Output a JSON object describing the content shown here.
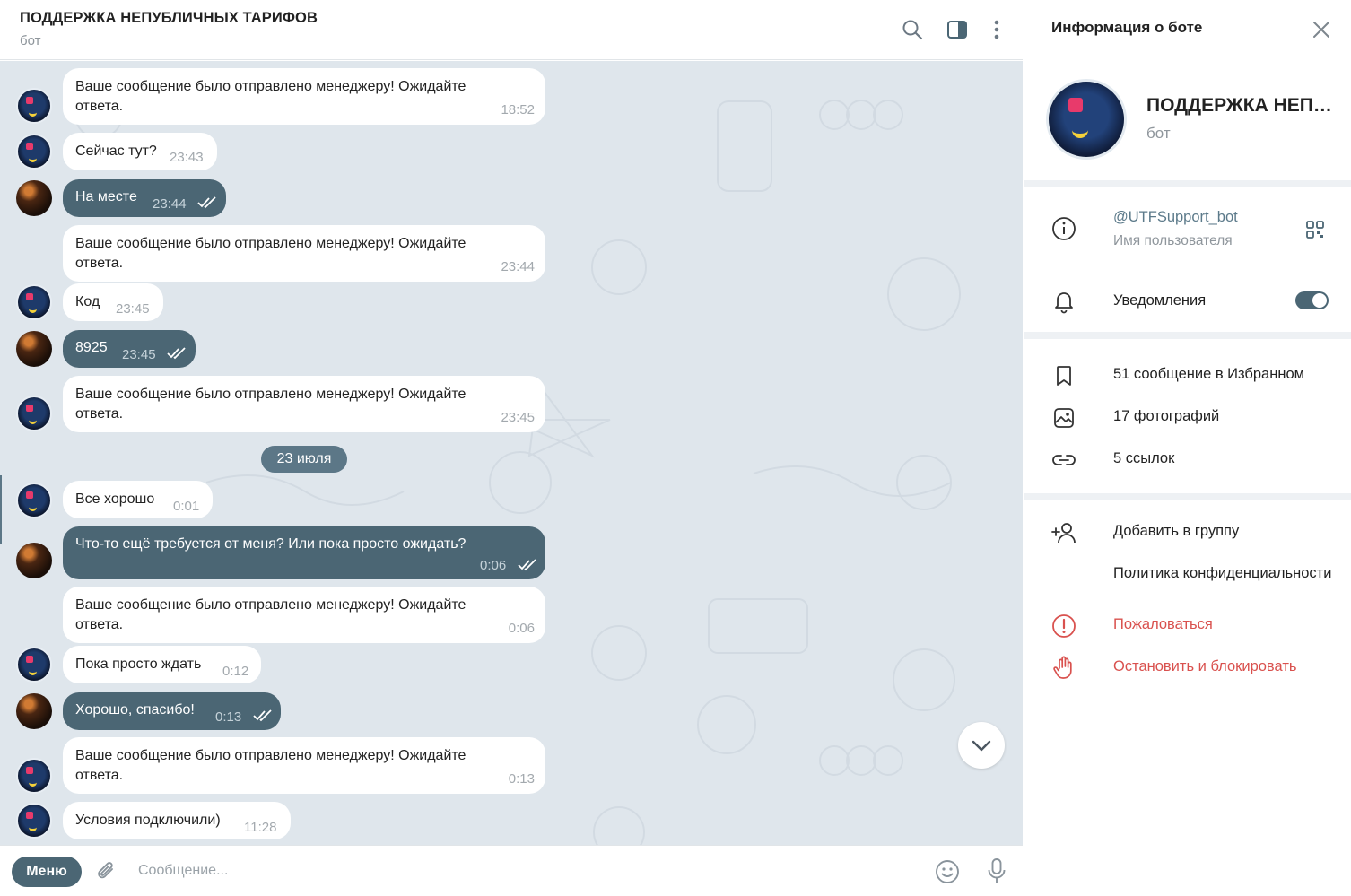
{
  "header": {
    "title": "ПОДДЕРЖКА НЕПУБЛИЧНЫХ ТАРИФОВ",
    "subtitle": "бот",
    "icons": [
      "search-icon",
      "sidebar-toggle-icon",
      "more-vertical-icon"
    ]
  },
  "messages": [
    {
      "from": "bot",
      "text": "Ваше сообщение было отправлено менеджеру! Ожидайте\nответа.",
      "time": "18:52"
    },
    {
      "from": "bot",
      "text": "Сейчас тут?",
      "time": "23:43"
    },
    {
      "from": "user",
      "text": "На месте",
      "time": "23:44"
    },
    {
      "from": "bot",
      "text": "Ваше сообщение было отправлено менеджеру! Ожидайте\nответа.",
      "time": "23:44"
    },
    {
      "from": "bot",
      "text": "Код",
      "time": "23:45"
    },
    {
      "from": "user",
      "text": "8925",
      "time": "23:45"
    },
    {
      "from": "bot",
      "text": "Ваше сообщение было отправлено менеджеру! Ожидайте\nответа.",
      "time": "23:45"
    },
    {
      "from": "bot",
      "text": "Все хорошо",
      "time": "0:01"
    },
    {
      "from": "user",
      "text": "Что-то ещё требуется от меня? Или пока просто ожидать?",
      "time": "0:06"
    },
    {
      "from": "bot",
      "text": "Ваше сообщение было отправлено менеджеру! Ожидайте\nответа.",
      "time": "0:06"
    },
    {
      "from": "bot",
      "text": "Пока просто ждать",
      "time": "0:12"
    },
    {
      "from": "user",
      "text": "Хорошо, спасибо!",
      "time": "0:13"
    },
    {
      "from": "bot",
      "text": "Ваше сообщение было отправлено менеджеру! Ожидайте\nответа.",
      "time": "0:13"
    },
    {
      "from": "bot",
      "text": "Условия подключили)",
      "time": "11:28"
    }
  ],
  "date_separator": "23 июля",
  "composer": {
    "menu_label": "Меню",
    "placeholder": "Сообщение..."
  },
  "side": {
    "title": "Информация о боте",
    "name": "ПОДДЕРЖКА НЕПУБЛИЧНЫХ ТАРИФОВ",
    "subtitle": "бот",
    "username": "@UTFSupport_bot",
    "username_label": "Имя пользователя",
    "notifications_label": "Уведомления",
    "notifications_on": true,
    "saved": "51 сообщение в Избранном",
    "photos": "17 фотографий",
    "links": "5 ссылок",
    "add_to_group": "Добавить в группу",
    "privacy": "Политика конфиденциальности",
    "report": "Пожаловаться",
    "block": "Остановить и блокировать"
  },
  "colors": {
    "accent": "#4b6674",
    "chat_bg": "#dfe6ec",
    "danger": "#d9514e"
  }
}
